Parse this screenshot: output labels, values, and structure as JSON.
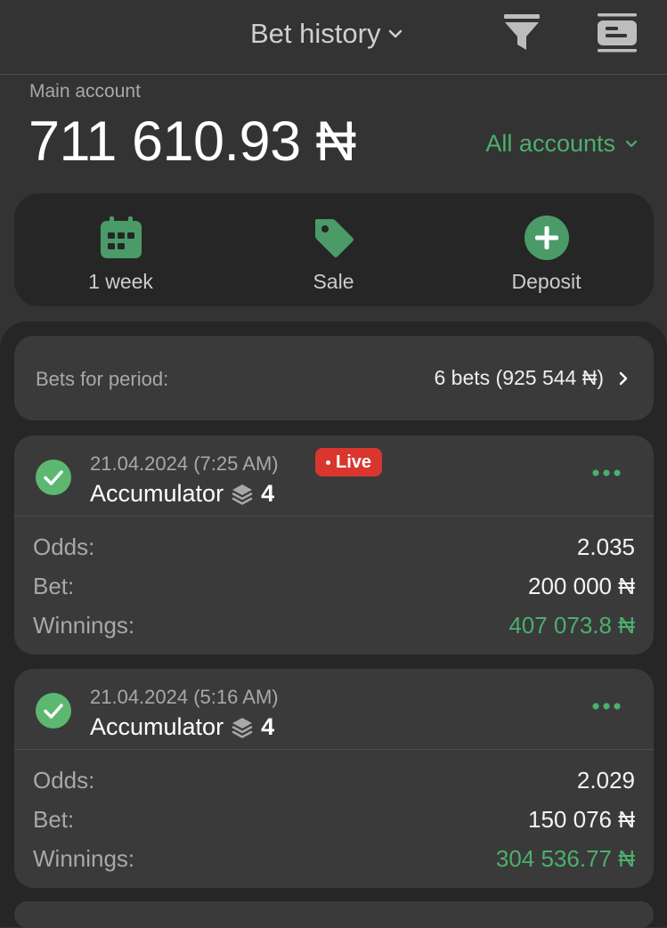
{
  "header": {
    "title": "Bet history"
  },
  "account": {
    "label": "Main account",
    "balance": "711 610.93 ₦",
    "all_accounts": "All accounts"
  },
  "actions": [
    {
      "label": "1 week",
      "icon": "calendar-icon"
    },
    {
      "label": "Sale",
      "icon": "tag-icon"
    },
    {
      "label": "Deposit",
      "icon": "plus-circle-icon"
    }
  ],
  "period": {
    "label": "Bets for period:",
    "value": "6 bets (925 544 ₦)"
  },
  "bets": [
    {
      "date": "21.04.2024",
      "time": "(7:25 AM)",
      "live": "Live",
      "type": "Accumulator",
      "count": "4",
      "odds_label": "Odds:",
      "odds": "2.035",
      "bet_label": "Bet:",
      "bet": "200 000 ₦",
      "winnings_label": "Winnings:",
      "winnings": "407 073.8 ₦"
    },
    {
      "date": "21.04.2024",
      "time": "(5:16 AM)",
      "type": "Accumulator",
      "count": "4",
      "odds_label": "Odds:",
      "odds": "2.029",
      "bet_label": "Bet:",
      "bet": "150 076 ₦",
      "winnings_label": "Winnings:",
      "winnings": "304 536.77 ₦"
    }
  ],
  "colors": {
    "accent_green": "#4caf6d",
    "live_red": "#d8362f",
    "background": "#333333",
    "panel": "#262626",
    "card": "#3a3a3a"
  }
}
